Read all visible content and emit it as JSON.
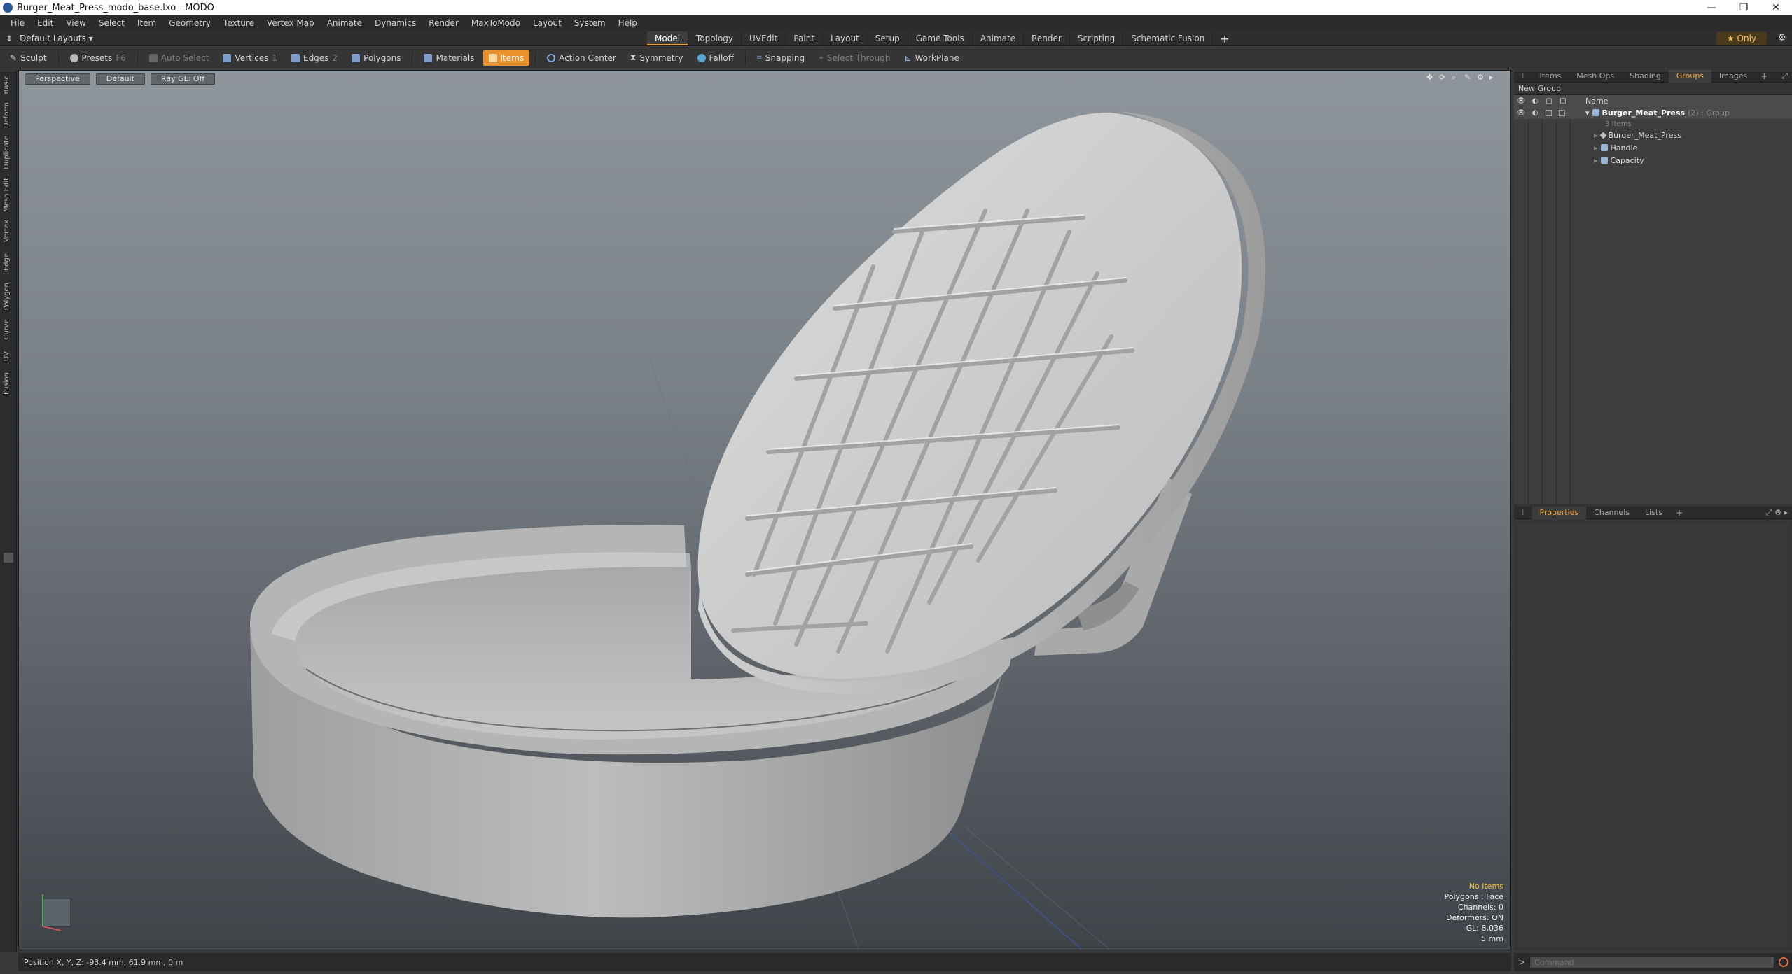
{
  "window": {
    "title": "Burger_Meat_Press_modo_base.lxo - MODO",
    "controls": [
      "—",
      "❐",
      "✕"
    ]
  },
  "menu": [
    "File",
    "Edit",
    "View",
    "Select",
    "Item",
    "Geometry",
    "Texture",
    "Vertex Map",
    "Animate",
    "Dynamics",
    "Render",
    "MaxToModo",
    "Layout",
    "System",
    "Help"
  ],
  "layout": {
    "dropdown": "Default Layouts ▾",
    "tabs": [
      "Model",
      "Topology",
      "UVEdit",
      "Paint",
      "Layout",
      "Setup",
      "Game Tools",
      "Animate",
      "Render",
      "Scripting",
      "Schematic Fusion"
    ],
    "active_tab": "Model",
    "only_label": "★ Only"
  },
  "toolbar": {
    "sculpt": "Sculpt",
    "presets": "Presets",
    "presets_key": "F6",
    "auto_select": "Auto Select",
    "vertices": "Vertices",
    "vertices_key": "1",
    "edges": "Edges",
    "edges_key": "2",
    "polygons": "Polygons",
    "materials": "Materials",
    "items": "Items",
    "action_center": "Action Center",
    "symmetry": "Symmetry",
    "falloff": "Falloff",
    "snapping": "Snapping",
    "select_through": "Select Through",
    "workplane": "WorkPlane"
  },
  "left_tabs": [
    "Basic",
    "Deform",
    "Duplicate",
    "Mesh Edit",
    "Vertex",
    "Edge",
    "Polygon",
    "Curve",
    "UV",
    "Fusion"
  ],
  "viewport": {
    "view": "Perspective",
    "shading": "Default",
    "raygl": "Ray GL: Off",
    "icons": [
      "✥",
      "⟳",
      "⌕",
      "✎",
      "⚙",
      "▸"
    ],
    "info": {
      "selection": "No Items",
      "polygons": "Polygons : Face",
      "channels": "Channels: 0",
      "deformers": "Deformers: ON",
      "gl": "GL: 8,036",
      "grid": "5 mm"
    }
  },
  "status": {
    "position": "Position X, Y, Z:  -93.4 mm, 61.9 mm, 0 m"
  },
  "command": {
    "prompt": ">",
    "placeholder": "Command"
  },
  "groups_panel": {
    "tabs": [
      "Items",
      "Mesh Ops",
      "Shading",
      "Groups",
      "Images"
    ],
    "active_tab": "Groups",
    "new_group": "New Group",
    "name_header": "Name",
    "tree": {
      "group_name": "Burger_Meat_Press",
      "group_suffix": "(2) : Group",
      "group_sub": "3 Items",
      "children": [
        "Burger_Meat_Press",
        "Handle",
        "Capacity"
      ]
    }
  },
  "props_panel": {
    "tabs": [
      "Properties",
      "Channels",
      "Lists"
    ],
    "active_tab": "Properties"
  }
}
